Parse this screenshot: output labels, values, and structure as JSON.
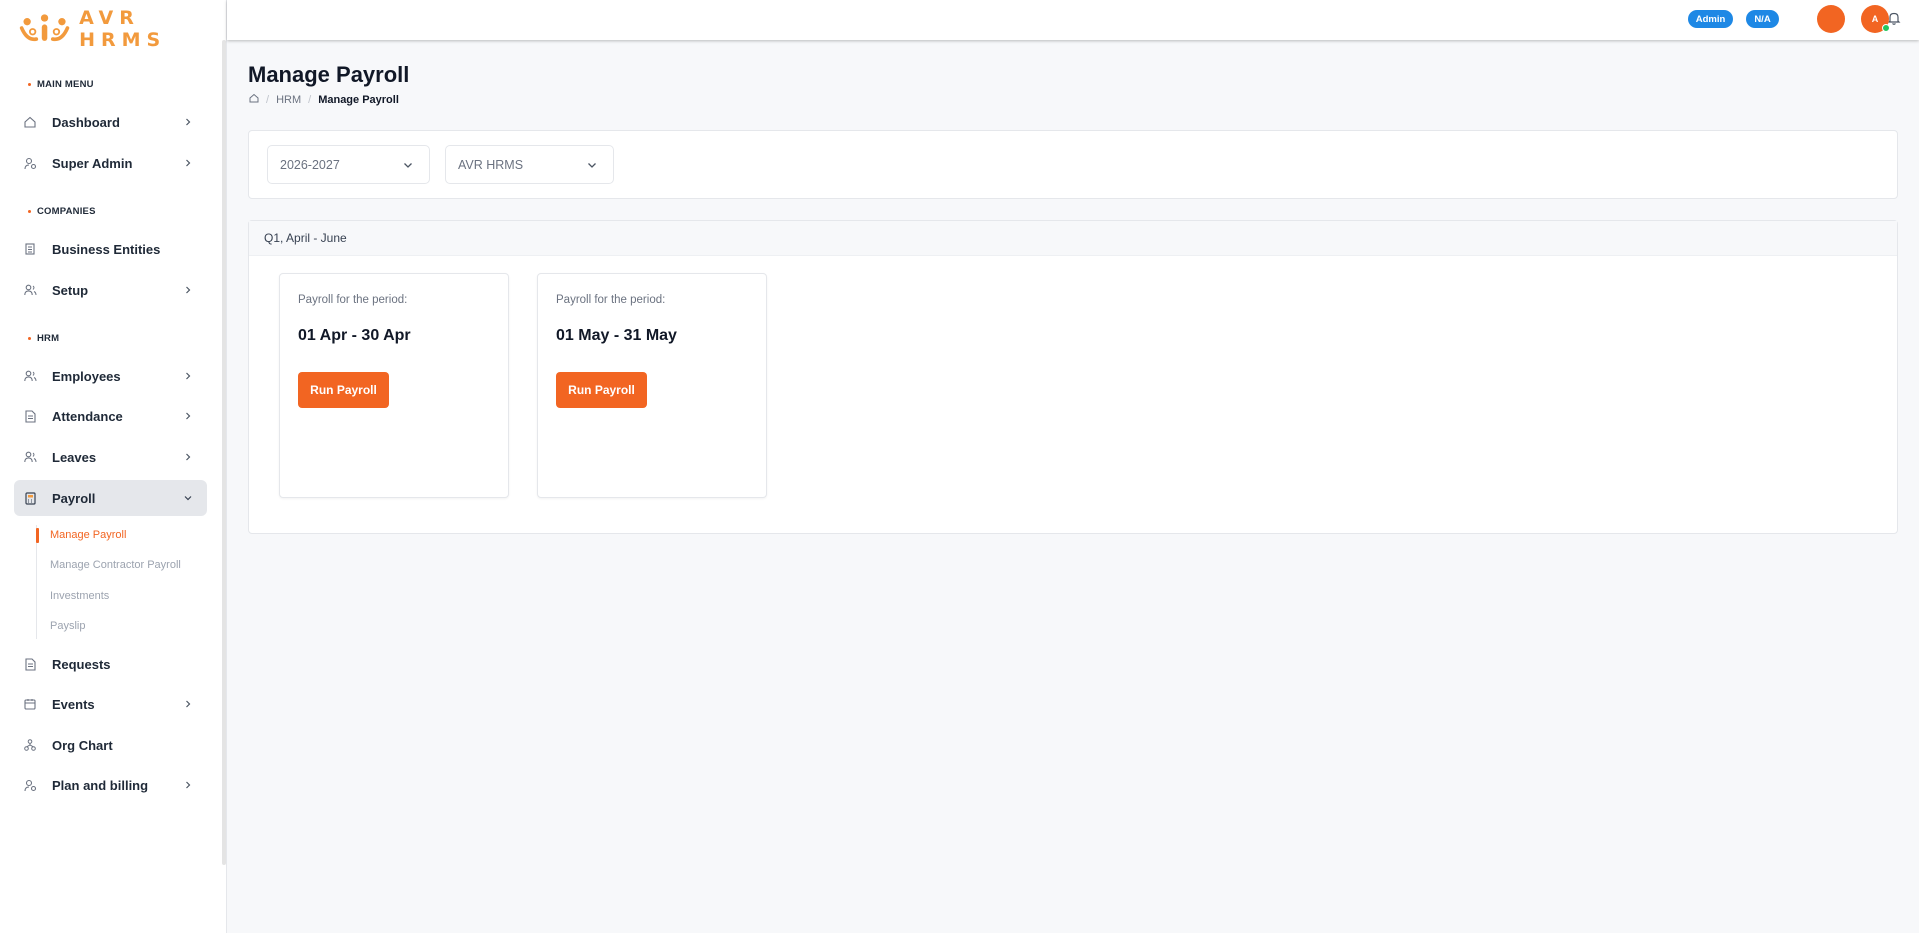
{
  "brand": {
    "name": "AVR HRMS",
    "accent": "#f26522",
    "logo_color": "#f29a3d"
  },
  "sidebar": {
    "sections": {
      "main_menu": "MAIN MENU",
      "companies": "COMPANIES",
      "hrm": "HRM"
    },
    "items": {
      "dashboard": "Dashboard",
      "super_admin": "Super Admin",
      "business_entities": "Business Entities",
      "setup": "Setup",
      "employees": "Employees",
      "attendance": "Attendance",
      "leaves": "Leaves",
      "payroll": "Payroll",
      "requests": "Requests",
      "events": "Events",
      "org_chart": "Org Chart",
      "plan_billing": "Plan and billing"
    },
    "payroll_sub": {
      "manage_payroll": "Manage Payroll",
      "manage_contractor_payroll": "Manage Contractor Payroll",
      "investments": "Investments",
      "payslip": "Payslip"
    }
  },
  "topbar": {
    "role_badge": "Admin",
    "na_badge": "N/A",
    "avatar_initial": "A",
    "badge_color": "#1e88e5"
  },
  "page": {
    "title": "Manage Payroll",
    "breadcrumb": {
      "hrm": "HRM",
      "current": "Manage Payroll"
    }
  },
  "filters": {
    "year": "2026-2027",
    "company": "AVR HRMS"
  },
  "quarter": {
    "label": "Q1, April - June",
    "periods": [
      {
        "label": "Payroll for the period:",
        "range": "01 Apr - 30 Apr",
        "button": "Run Payroll"
      },
      {
        "label": "Payroll for the period:",
        "range": "01 May - 31 May",
        "button": "Run Payroll"
      }
    ]
  }
}
